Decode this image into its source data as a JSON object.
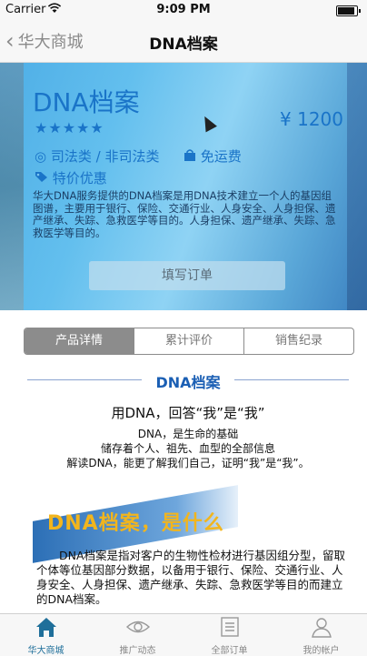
{
  "status_bar": {
    "carrier": "Carrier",
    "time": "9:09 PM"
  },
  "nav": {
    "back_label": "华大商城",
    "title": "DNA档案"
  },
  "product": {
    "title": "DNA档案",
    "stars": "★★★★★",
    "price": "¥ 1200",
    "category": "司法类 / 非司法类",
    "shipping": "免运费",
    "promo": "特价优惠",
    "description": "华大DNA服务提供的DNA档案是用DNA技术建立一个人的基因组图谱，主要用于银行、保险、交通行业、人身安全、人身担保、遗产继承、失踪、急救医学等目的。人身担保、遗产继承、失踪、急救医学等目的。",
    "order_button": "填写订单"
  },
  "tabs": [
    {
      "label": "产品详情"
    },
    {
      "label": "累计评价"
    },
    {
      "label": "销售纪录"
    }
  ],
  "detail": {
    "header": "DNA档案",
    "question": "用DNA，回答“我”是“我”",
    "lines": [
      "DNA，是生命的基础",
      "储存着个人、祖先、血型的全部信息",
      "解读DNA，能更了解我们自己，证明“我”是“我”。"
    ],
    "banner": "DNA档案，是什么",
    "paragraph": "DNA档案是指对客户的生物性检材进行基因组分型，留取个体等位基因部分数据，以备用于银行、保险、交通行业、人身安全、人身担保、遗产继承、失踪、急救医学等目的而建立的DNA档案。"
  },
  "tabbar": [
    {
      "label": "华大商城",
      "icon": "home-icon",
      "active": true
    },
    {
      "label": "推广动态",
      "icon": "eye-icon",
      "active": false
    },
    {
      "label": "全部订单",
      "icon": "list-icon",
      "active": false
    },
    {
      "label": "我的帐户",
      "icon": "user-icon",
      "active": false
    }
  ],
  "colors": {
    "accent": "#1a74c8",
    "tab_active": "#1f6f9a"
  }
}
